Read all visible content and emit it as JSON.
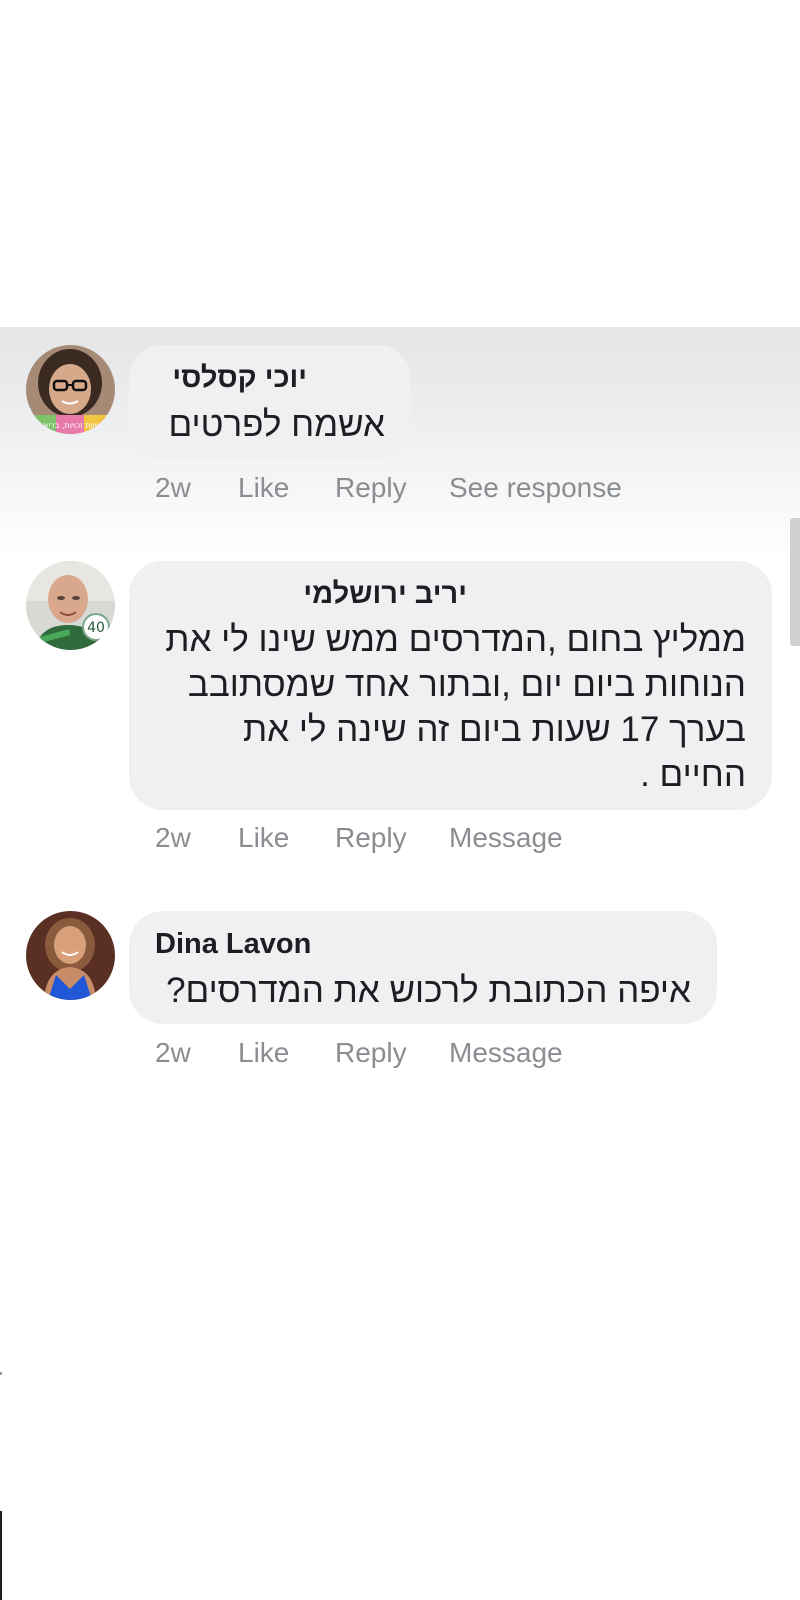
{
  "comments": [
    {
      "author": "יוכי קסלסי",
      "text": "אשמח לפרטים",
      "time": "2w",
      "actions": [
        "Like",
        "Reply",
        "See response"
      ],
      "avatar_icon": "woman-with-glasses-avatar",
      "avatar_text": "חוויות זכויות, בריאות"
    },
    {
      "author": "יריב ירושלמי",
      "text": "ממליץ בחום ,המדרסים ממש שינו לי את הנוחות ביום יום ,ובתור אחד שמסתובב בערך  17 שעות ביום זה שינה לי את החיים .",
      "time": "2w",
      "actions": [
        "Like",
        "Reply",
        "Message"
      ],
      "avatar_icon": "bald-man-avatar",
      "avatar_text": "40"
    },
    {
      "author": "Dina Lavon",
      "text": "איפה הכתובת לרכוש את המדרסים?",
      "time": "2w",
      "actions": [
        "Like",
        "Reply",
        "Message"
      ],
      "avatar_icon": "woman-blue-dress-avatar"
    }
  ],
  "colors": {
    "bubble": "#eff0f2",
    "author": "#1c1e21",
    "action": "#8a8d91",
    "highlight": "#e4e5e7"
  }
}
